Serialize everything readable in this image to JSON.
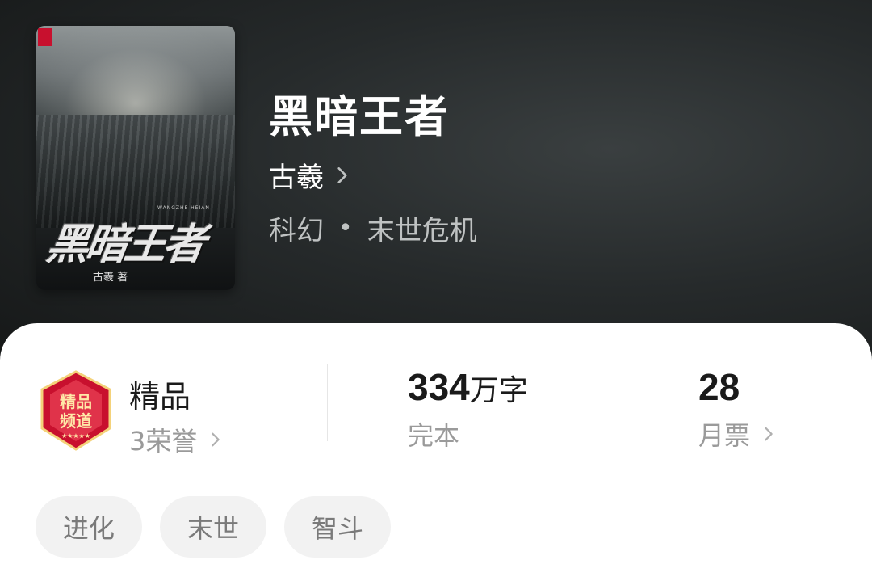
{
  "book": {
    "title": "黑暗王者",
    "author": "古羲",
    "category": "科幻",
    "subcategory": "末世危机",
    "cover": {
      "title_art": "黑暗王者",
      "pinyin": "WANGZHE HEIAN",
      "byline": "古羲 著",
      "icon": "cover-art-city-ruins"
    }
  },
  "stats": {
    "quality": {
      "label": "精品",
      "honors": "3荣誉",
      "badge_text": "精品频道"
    },
    "words": {
      "number": "334",
      "unit": "万字",
      "status": "完本"
    },
    "votes": {
      "number": "28",
      "label": "月票"
    }
  },
  "tags": [
    "进化",
    "末世",
    "智斗"
  ],
  "colors": {
    "hero_bg": "#262a2b",
    "badge_red": "#c8102e",
    "badge_gold": "#f4d27a",
    "tag_bg": "#f2f2f2",
    "text_gray": "#9a9a9a"
  }
}
